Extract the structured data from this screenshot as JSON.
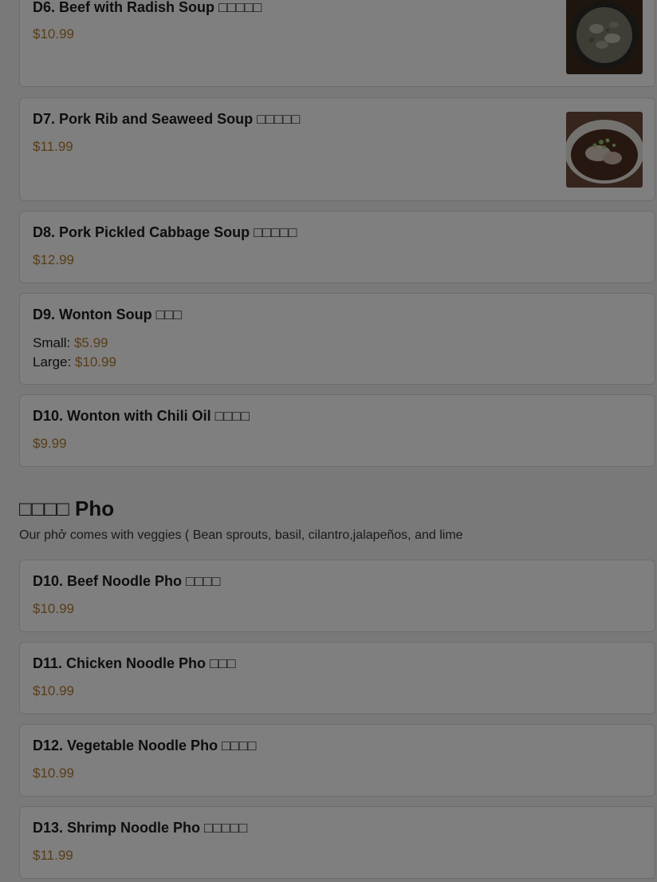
{
  "soups": [
    {
      "name": "D6. Beef with Radish Soup □□□□□",
      "price": "$10.99",
      "image": "beef-radish-soup-photo"
    },
    {
      "name": "D7. Pork Rib and Seaweed Soup □□□□□",
      "price": "$11.99",
      "image": "pork-rib-seaweed-soup-photo"
    },
    {
      "name": "D8. Pork Pickled Cabbage Soup □□□□□",
      "price": "$12.99"
    },
    {
      "name": "D9. Wonton Soup □□□",
      "small_label": "Small: ",
      "small_price": "$5.99",
      "large_label": "Large: ",
      "large_price": "$10.99"
    },
    {
      "name": "D10. Wonton with Chili Oil □□□□",
      "price": "$9.99"
    }
  ],
  "pho_section": {
    "title": "□□□□ Pho",
    "description": "Our phở comes with veggies ( Bean sprouts, basil, cilantro,jalapeños, and lime"
  },
  "pho": [
    {
      "name": "D10. Beef Noodle Pho □□□□",
      "price": "$10.99"
    },
    {
      "name": "D11. Chicken Noodle Pho □□□",
      "price": "$10.99"
    },
    {
      "name": "D12. Vegetable Noodle Pho □□□□",
      "price": "$10.99"
    },
    {
      "name": "D13. Shrimp Noodle Pho □□□□□",
      "price": "$11.99"
    }
  ],
  "colors": {
    "price": "#b07a2e",
    "overlay": "rgba(0,0,0,0.5)"
  }
}
